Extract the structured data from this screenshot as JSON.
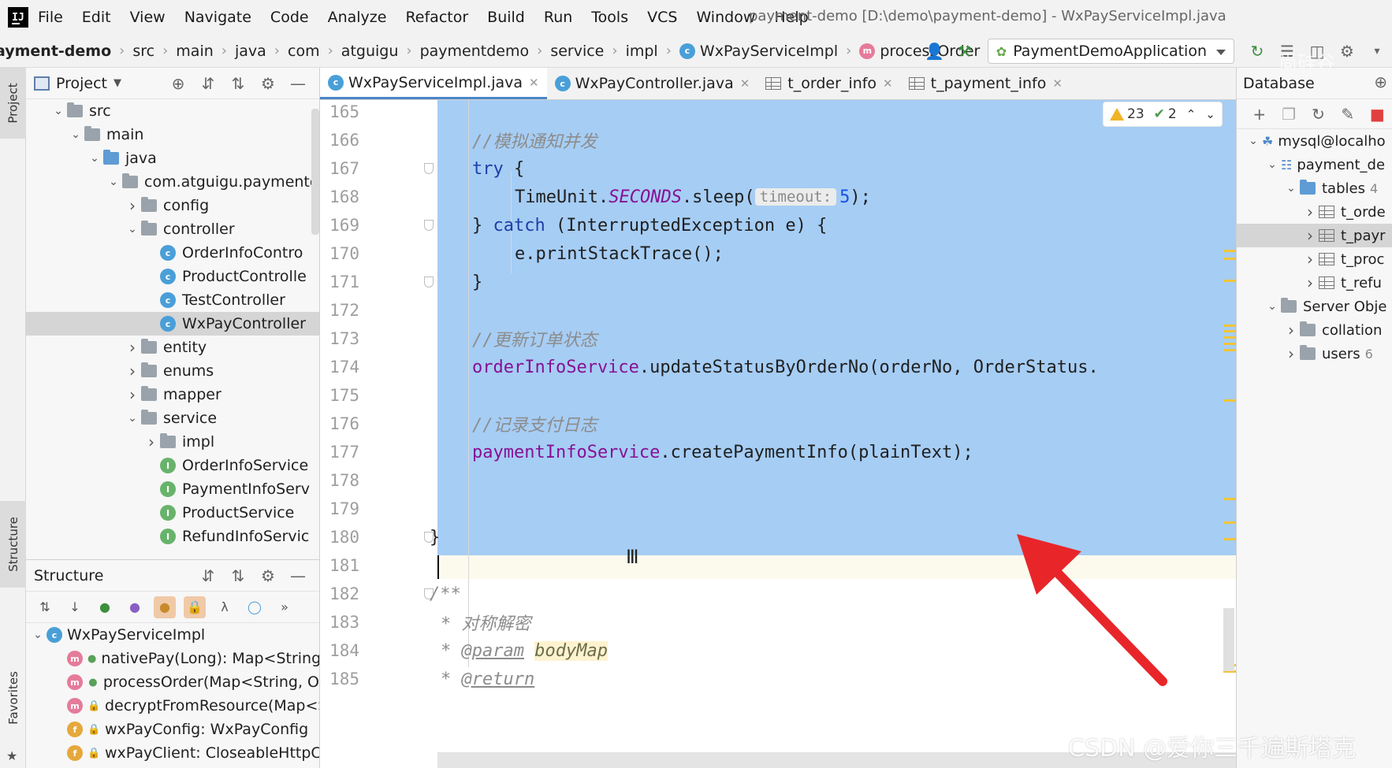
{
  "menu": {
    "items": [
      "File",
      "Edit",
      "View",
      "Navigate",
      "Code",
      "Analyze",
      "Refactor",
      "Build",
      "Run",
      "Tools",
      "VCS",
      "Window",
      "Help"
    ],
    "window_title": "payment-demo [D:\\demo\\payment-demo] - WxPayServiceImpl.java"
  },
  "breadcrumbs": [
    "ayment-demo",
    "src",
    "main",
    "java",
    "com",
    "atguigu",
    "paymentdemo",
    "service",
    "impl",
    "WxPayServiceImpl",
    "processOrder"
  ],
  "run_config": "PaymentDemoApplication",
  "project_panel": {
    "title": "Project",
    "tree": [
      {
        "label": "src",
        "kind": "folder",
        "expanded": true
      },
      {
        "label": "main",
        "kind": "folder",
        "expanded": true
      },
      {
        "label": "java",
        "kind": "folder-blue",
        "expanded": true
      },
      {
        "label": "com.atguigu.paymentd",
        "kind": "package",
        "expanded": true
      },
      {
        "label": "config",
        "kind": "package",
        "expanded": false
      },
      {
        "label": "controller",
        "kind": "package",
        "expanded": true
      },
      {
        "label": "OrderInfoContro",
        "kind": "class"
      },
      {
        "label": "ProductControlle",
        "kind": "class"
      },
      {
        "label": "TestController",
        "kind": "class"
      },
      {
        "label": "WxPayController",
        "kind": "class",
        "selected": true
      },
      {
        "label": "entity",
        "kind": "package",
        "expanded": false
      },
      {
        "label": "enums",
        "kind": "package",
        "expanded": false
      },
      {
        "label": "mapper",
        "kind": "package",
        "expanded": false
      },
      {
        "label": "service",
        "kind": "package",
        "expanded": true
      },
      {
        "label": "impl",
        "kind": "package",
        "expanded": false
      },
      {
        "label": "OrderInfoService",
        "kind": "interface"
      },
      {
        "label": "PaymentInfoServ",
        "kind": "interface"
      },
      {
        "label": "ProductService",
        "kind": "interface"
      },
      {
        "label": "RefundInfoServic",
        "kind": "interface"
      }
    ]
  },
  "structure_panel": {
    "title": "Structure",
    "root": "WxPayServiceImpl",
    "items": [
      {
        "label": "nativePay(Long): Map<String,",
        "kind": "method"
      },
      {
        "label": "processOrder(Map<String, O",
        "kind": "method"
      },
      {
        "label": "decryptFromResource(Map<S",
        "kind": "method-locked"
      },
      {
        "label": "wxPayConfig: WxPayConfig",
        "kind": "field-locked"
      },
      {
        "label": "wxPayClient: CloseableHttpCli",
        "kind": "field-locked"
      }
    ]
  },
  "left_strip": {
    "project": "Project",
    "structure": "Structure",
    "favorites": "Favorites"
  },
  "editor_tabs": [
    {
      "label": "WxPayServiceImpl.java",
      "kind": "class",
      "active": true
    },
    {
      "label": "WxPayController.java",
      "kind": "class",
      "active": false
    },
    {
      "label": "t_order_info",
      "kind": "table",
      "active": false
    },
    {
      "label": "t_payment_info",
      "kind": "table",
      "active": false
    }
  ],
  "inspections": {
    "warnings": "23",
    "weak_warnings": "2"
  },
  "code": {
    "line_numbers": [
      "165",
      "166",
      "167",
      "168",
      "169",
      "170",
      "171",
      "172",
      "173",
      "174",
      "175",
      "176",
      "177",
      "178",
      "179",
      "180",
      "181",
      "182",
      "183",
      "184",
      "185"
    ],
    "comment_simulate": "//模拟通知并发",
    "try_kw": "try",
    "timeunit": "TimeUnit.",
    "seconds": "SECONDS",
    "sleep": ".sleep(",
    "hint_timeout": "timeout:",
    "sleep_value": "5",
    "sleep_end": ");",
    "catch_open": "} ",
    "catch_kw": "catch",
    "catch_rest": " (InterruptedException e) {",
    "print_trace": "e.printStackTrace();",
    "close_brace": "}",
    "comment_update": "//更新订单状态",
    "order_service": "orderInfoService",
    "update_call": ".updateStatusByOrderNo(orderNo, OrderStatus.",
    "comment_log": "//记录支付日志",
    "payment_service": "paymentInfoService",
    "create_call": ".createPaymentInfo(plainText);",
    "doc_open": "/**",
    "doc_desc": "* 对称解密",
    "doc_star": "* ",
    "doc_param_tag": "@param",
    "doc_param_name": "bodyMap",
    "doc_return_tag": "@return"
  },
  "database_panel": {
    "title": "Database",
    "tree": [
      {
        "label": "mysql@localho",
        "level": 0
      },
      {
        "label": "payment_de",
        "level": 1
      },
      {
        "label": "tables",
        "count": "4",
        "level": 2
      },
      {
        "label": "t_orde",
        "level": 3
      },
      {
        "label": "t_payr",
        "level": 3,
        "selected": true
      },
      {
        "label": "t_proc",
        "level": 3
      },
      {
        "label": "t_refu",
        "level": 3
      },
      {
        "label": "Server Obje",
        "level": 1
      },
      {
        "label": "collation",
        "level": 2
      },
      {
        "label": "users",
        "count": "6",
        "level": 2
      }
    ]
  },
  "watermark": "CSDN @爱你三千遍斯塔克",
  "faint_watermark": "尚硅谷",
  "colors": {
    "selection": "#a6cdf4",
    "keyword": "#1f3ea8",
    "field": "#871094",
    "annotation_arrow": "#e8262a"
  }
}
